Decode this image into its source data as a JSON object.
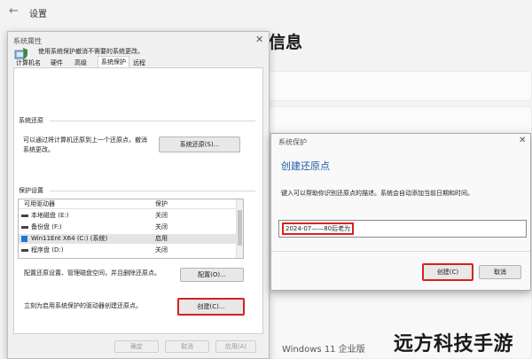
{
  "settings": {
    "back_glyph": "←",
    "title": "设置",
    "heading": "信息",
    "edition": "Windows 11 企业版"
  },
  "system_properties": {
    "title": "系统属性",
    "close_glyph": "✕",
    "tabs": [
      "计算机名",
      "硬件",
      "高级",
      "系统保护",
      "远程"
    ],
    "active_tab": "系统保护",
    "intro": "使用系统保护撤消不需要的系统更改。",
    "restore_section_label": "系统还原",
    "restore_text_1": "可以通过将计算机还原到上一个还原点，撤消",
    "restore_text_2": "系统更改。",
    "restore_button": "系统还原(S)...",
    "protection_section_label": "保护设置",
    "list_headers": [
      "可用驱动器",
      "保护"
    ],
    "drives": [
      {
        "name": "本地磁盘 (E:)",
        "status": "关闭",
        "icon": "drive-icon"
      },
      {
        "name": "备份盘 (F:)",
        "status": "关闭",
        "icon": "drive-icon"
      },
      {
        "name": "Win11Ent X64 (C:) (系统)",
        "status": "启用",
        "icon": "windows-drive-icon"
      },
      {
        "name": "程序盘 (D:)",
        "status": "关闭",
        "icon": "drive-icon"
      }
    ],
    "configure_text": "配置还原设置、管理磁盘空间，并且删除还原点。",
    "configure_button": "配置(O)...",
    "create_text": "立刻为启用系统保护的驱动器创建还原点。",
    "create_button": "创建(C)...",
    "ok_button": "确定",
    "cancel_button": "取消",
    "apply_button": "应用(A)"
  },
  "create_dialog": {
    "title": "系统保护",
    "close_glyph": "✕",
    "heading": "创建还原点",
    "description": "键入可以帮助你识别还原点的描述。系统会自动添加当前日期和时间。",
    "input_value": "2024-07——80后老为",
    "create_button": "创建(C)",
    "cancel_button": "取消"
  },
  "watermark": "远方科技手游",
  "colors": {
    "highlight_red": "#d32222",
    "heading_blue": "#1a5da6",
    "windows_blue": "#1e78d4"
  }
}
